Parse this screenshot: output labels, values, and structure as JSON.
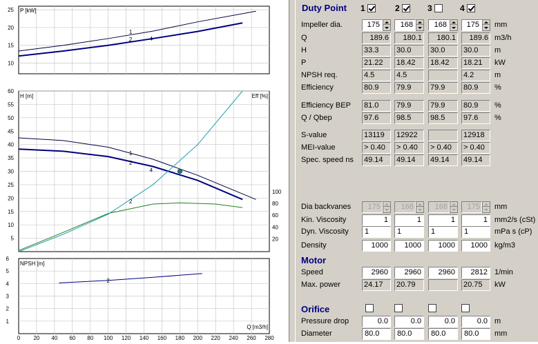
{
  "panel": {
    "duty_point_title": "Duty Point",
    "points": [
      {
        "num": "1",
        "checked": true
      },
      {
        "num": "2",
        "checked": true
      },
      {
        "num": "3",
        "checked": false
      },
      {
        "num": "4",
        "checked": true
      }
    ],
    "rows": {
      "impeller": {
        "label": "Impeller dia.",
        "values": [
          "175",
          "168",
          "168",
          "175"
        ],
        "unit": "mm"
      },
      "q": {
        "label": "Q",
        "values": [
          "189.6",
          "180.1",
          "180.1",
          "189.6"
        ],
        "unit": "m3/h"
      },
      "h": {
        "label": "H",
        "values": [
          "33.3",
          "30.0",
          "30.0",
          "30.0"
        ],
        "unit": "m"
      },
      "p": {
        "label": "P",
        "values": [
          "21.22",
          "18.42",
          "18.42",
          "18.21"
        ],
        "unit": "kW"
      },
      "npsh": {
        "label": "NPSH req.",
        "values": [
          "4.5",
          "4.5",
          "",
          "4.2"
        ],
        "unit": "m"
      },
      "eff": {
        "label": "Efficiency",
        "values": [
          "80.9",
          "79.9",
          "79.9",
          "80.9"
        ],
        "unit": "%"
      },
      "eff_bep": {
        "label": "Efficiency BEP",
        "values": [
          "81.0",
          "79.9",
          "79.9",
          "80.9"
        ],
        "unit": "%"
      },
      "q_qbep": {
        "label": "Q / Qbep",
        "values": [
          "97.6",
          "98.5",
          "98.5",
          "97.6"
        ],
        "unit": "%"
      },
      "s_value": {
        "label": "S-value",
        "values": [
          "13119",
          "12922",
          "",
          "12918"
        ],
        "unit": ""
      },
      "mei": {
        "label": "MEI-value",
        "values": [
          "> 0.40",
          "> 0.40",
          "> 0.40",
          "> 0.40"
        ],
        "unit": ""
      },
      "spec_speed": {
        "label": "Spec. speed ns",
        "values": [
          "49.14",
          "49.14",
          "49.14",
          "49.14"
        ],
        "unit": ""
      },
      "dia_backvanes": {
        "label": "Dia backvanes",
        "values": [
          "175",
          "168",
          "168",
          "175"
        ],
        "unit": "mm"
      },
      "kin_visc": {
        "label": "Kin. Viscosity",
        "values": [
          "1",
          "1",
          "1",
          "1"
        ],
        "unit": "mm2/s (cSt)"
      },
      "dyn_visc": {
        "label": "Dyn. Viscosity",
        "values": [
          "1",
          "1",
          "1",
          "1"
        ],
        "unit": "mPa s (cP)"
      },
      "density": {
        "label": "Density",
        "values": [
          "1000",
          "1000",
          "1000",
          "1000"
        ],
        "unit": "kg/m3"
      }
    },
    "motor_title": "Motor",
    "motor": {
      "speed": {
        "label": "Speed",
        "values": [
          "2960",
          "2960",
          "2960",
          "2812"
        ],
        "unit": "1/min"
      },
      "max_power": {
        "label": "Max. power",
        "values": [
          "24.17",
          "20.79",
          "",
          "20.75"
        ],
        "unit": "kW"
      }
    },
    "orifice_title": "Orifice",
    "orifice_checks": [
      false,
      false,
      false,
      false
    ],
    "orifice": {
      "pressure_drop": {
        "label": "Pressure drop",
        "values": [
          "0.0",
          "0.0",
          "0.0",
          "0.0"
        ],
        "unit": "m"
      },
      "diameter": {
        "label": "Diameter",
        "values": [
          "80.0",
          "80.0",
          "80.0",
          "80.0"
        ],
        "unit": "mm"
      }
    }
  },
  "chart_data": [
    {
      "type": "line",
      "ylabel": "P [kW]",
      "ylim": [
        10,
        25
      ],
      "yticks": [
        "10",
        "15",
        "20",
        "25"
      ],
      "series": [
        {
          "name": "1",
          "x": [
            0,
            50,
            100,
            150,
            200,
            265
          ],
          "y": [
            13.4,
            15.0,
            16.9,
            19.0,
            21.6,
            24.6
          ]
        },
        {
          "name": "2",
          "x": [
            0,
            50,
            100,
            150,
            200,
            250
          ],
          "y": [
            12.0,
            13.4,
            15.0,
            16.9,
            18.9,
            21.3
          ]
        },
        {
          "name": "4",
          "x": [
            0,
            50,
            100,
            150,
            200,
            250
          ],
          "y": [
            12.0,
            13.4,
            15.0,
            16.9,
            18.9,
            21.3
          ]
        }
      ]
    },
    {
      "type": "line",
      "ylabel": "H [m]",
      "y2label": "Eff [%]",
      "ylim": [
        0,
        60
      ],
      "yticks": [
        "5",
        "10",
        "15",
        "20",
        "25",
        "30",
        "35",
        "40",
        "45",
        "50",
        "55",
        "60"
      ],
      "y2ticks": [
        "20",
        "40",
        "60",
        "80",
        "100"
      ],
      "series": [
        {
          "name": "1",
          "x": [
            0,
            50,
            100,
            150,
            200,
            265
          ],
          "y": [
            42.5,
            41.5,
            39.0,
            34.5,
            28.5,
            19.5
          ]
        },
        {
          "name": "2",
          "x": [
            0,
            50,
            100,
            150,
            200,
            250
          ],
          "y": [
            38.3,
            37.5,
            35.5,
            31.8,
            26.6,
            19.5
          ]
        },
        {
          "name": "4",
          "x": [
            0,
            50,
            100,
            150,
            200,
            250
          ],
          "y": [
            38.3,
            37.5,
            35.5,
            31.8,
            26.6,
            19.5
          ]
        },
        {
          "name": "2",
          "x": [
            0,
            50,
            100,
            150,
            180,
            220,
            250
          ],
          "y": [
            0,
            31,
            63,
            79,
            81,
            79,
            73
          ]
        },
        {
          "name": "",
          "x": [
            0,
            50,
            100,
            150,
            200,
            250
          ],
          "y": [
            0,
            6.5,
            14,
            25,
            40,
            60
          ]
        }
      ],
      "duty_point": {
        "x": 180.1,
        "y": 30.0
      }
    },
    {
      "type": "line",
      "ylabel": "NPSH [m]",
      "xlabel": "Q [m3/h]",
      "ylim": [
        0,
        6
      ],
      "yticks": [
        "1",
        "2",
        "3",
        "4",
        "5",
        "6"
      ],
      "xticks": [
        "0",
        "20",
        "40",
        "60",
        "80",
        "100",
        "120",
        "140",
        "160",
        "180",
        "200",
        "220",
        "240",
        "260",
        "280"
      ],
      "series": [
        {
          "name": "2",
          "x": [
            45,
            100,
            150,
            205
          ],
          "y": [
            4.05,
            4.25,
            4.5,
            4.8
          ]
        }
      ]
    }
  ]
}
